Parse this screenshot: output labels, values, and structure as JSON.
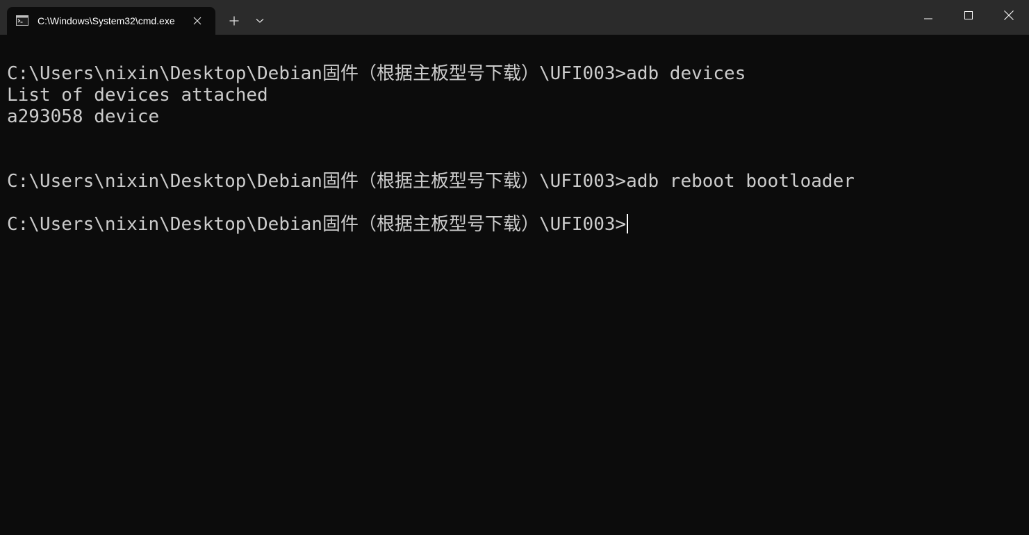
{
  "window": {
    "tab_title": "C:\\Windows\\System32\\cmd.exe",
    "tab_icon": "cmd-icon",
    "new_tab_icon": "plus-icon",
    "dropdown_icon": "chevron-down-icon",
    "minimize_icon": "minimize-icon",
    "maximize_icon": "maximize-icon",
    "close_icon": "close-icon"
  },
  "colors": {
    "titlebar_bg": "#2b2b2b",
    "terminal_bg": "#0c0c0c",
    "terminal_text": "#cccccc",
    "title_text": "#ffffff"
  },
  "terminal": {
    "lines": [
      "C:\\Users\\nixin\\Desktop\\Debian固件（根据主板型号下载）\\UFI003>adb devices",
      "List of devices attached",
      "a293058 device",
      "C:\\Users\\nixin\\Desktop\\Debian固件（根据主板型号下载）\\UFI003>adb reboot bootloader",
      "C:\\Users\\nixin\\Desktop\\Debian固件（根据主板型号下载）\\UFI003>"
    ]
  }
}
